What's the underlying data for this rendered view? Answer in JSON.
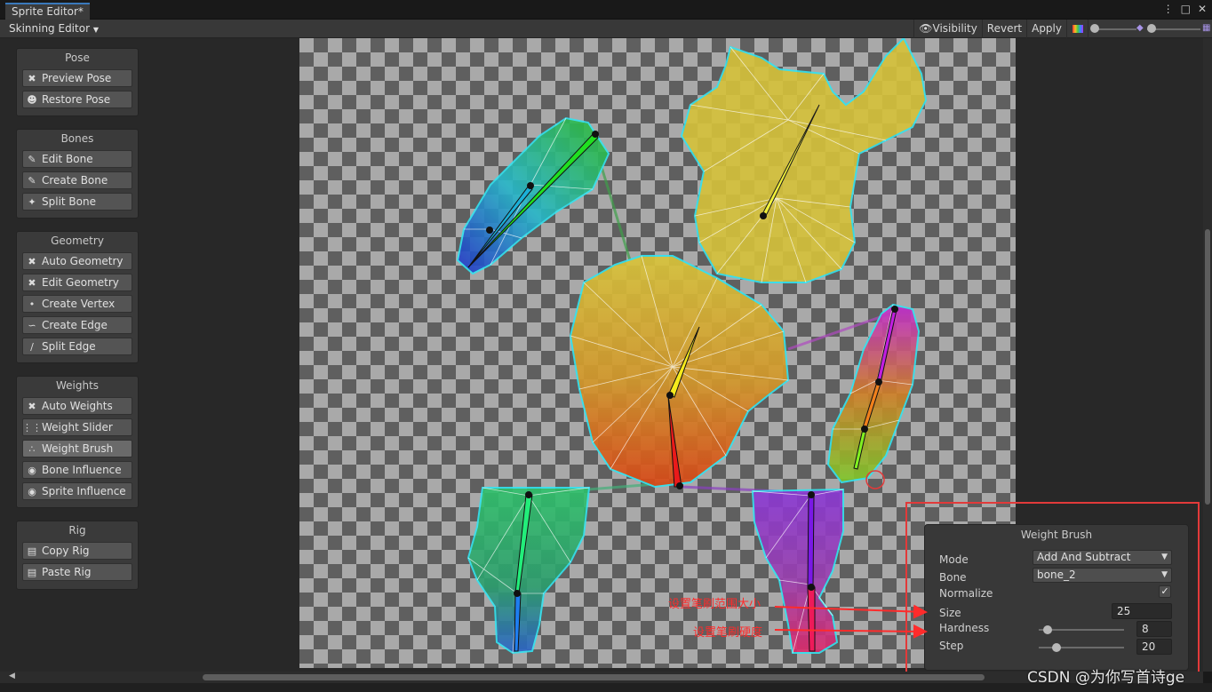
{
  "window": {
    "tab_title": "Sprite Editor*",
    "menu_icon": "kebab-menu-icon",
    "maximize_icon": "maximize-icon",
    "close_icon": "close-icon"
  },
  "toolbar": {
    "mode_label": "Skinning Editor",
    "visibility_label": "Visibility",
    "revert_label": "Revert",
    "apply_label": "Apply"
  },
  "panels": {
    "pose": {
      "title": "Pose",
      "items": [
        {
          "label": "Preview Pose",
          "icon": "preview-pose-icon"
        },
        {
          "label": "Restore Pose",
          "icon": "restore-pose-icon"
        }
      ]
    },
    "bones": {
      "title": "Bones",
      "items": [
        {
          "label": "Edit Bone",
          "icon": "edit-bone-icon"
        },
        {
          "label": "Create Bone",
          "icon": "create-bone-icon"
        },
        {
          "label": "Split Bone",
          "icon": "split-bone-icon"
        }
      ]
    },
    "geometry": {
      "title": "Geometry",
      "items": [
        {
          "label": "Auto Geometry",
          "icon": "auto-geometry-icon"
        },
        {
          "label": "Edit Geometry",
          "icon": "edit-geometry-icon"
        },
        {
          "label": "Create Vertex",
          "icon": "create-vertex-icon"
        },
        {
          "label": "Create Edge",
          "icon": "create-edge-icon"
        },
        {
          "label": "Split Edge",
          "icon": "split-edge-icon"
        }
      ]
    },
    "weights": {
      "title": "Weights",
      "items": [
        {
          "label": "Auto Weights",
          "icon": "auto-weights-icon"
        },
        {
          "label": "Weight Slider",
          "icon": "weight-slider-icon"
        },
        {
          "label": "Weight Brush",
          "icon": "weight-brush-icon",
          "active": true
        },
        {
          "label": "Bone Influence",
          "icon": "bone-influence-icon"
        },
        {
          "label": "Sprite Influence",
          "icon": "sprite-influence-icon"
        }
      ]
    },
    "rig": {
      "title": "Rig",
      "items": [
        {
          "label": "Copy Rig",
          "icon": "copy-rig-icon"
        },
        {
          "label": "Paste Rig",
          "icon": "paste-rig-icon"
        }
      ]
    }
  },
  "weight_brush": {
    "title": "Weight Brush",
    "mode_label": "Mode",
    "mode_value": "Add And Subtract",
    "bone_label": "Bone",
    "bone_value": "bone_2",
    "normalize_label": "Normalize",
    "normalize_checked": true,
    "size_label": "Size",
    "size_value": "25",
    "hardness_label": "Hardness",
    "hardness_value": "8",
    "step_label": "Step",
    "step_value": "20"
  },
  "annotations": {
    "size_note": "设置笔刷范围大小",
    "hardness_note": "设置笔刷硬度",
    "color": "#ff2b2b"
  },
  "watermark": "CSDN @为你写首诗ge"
}
